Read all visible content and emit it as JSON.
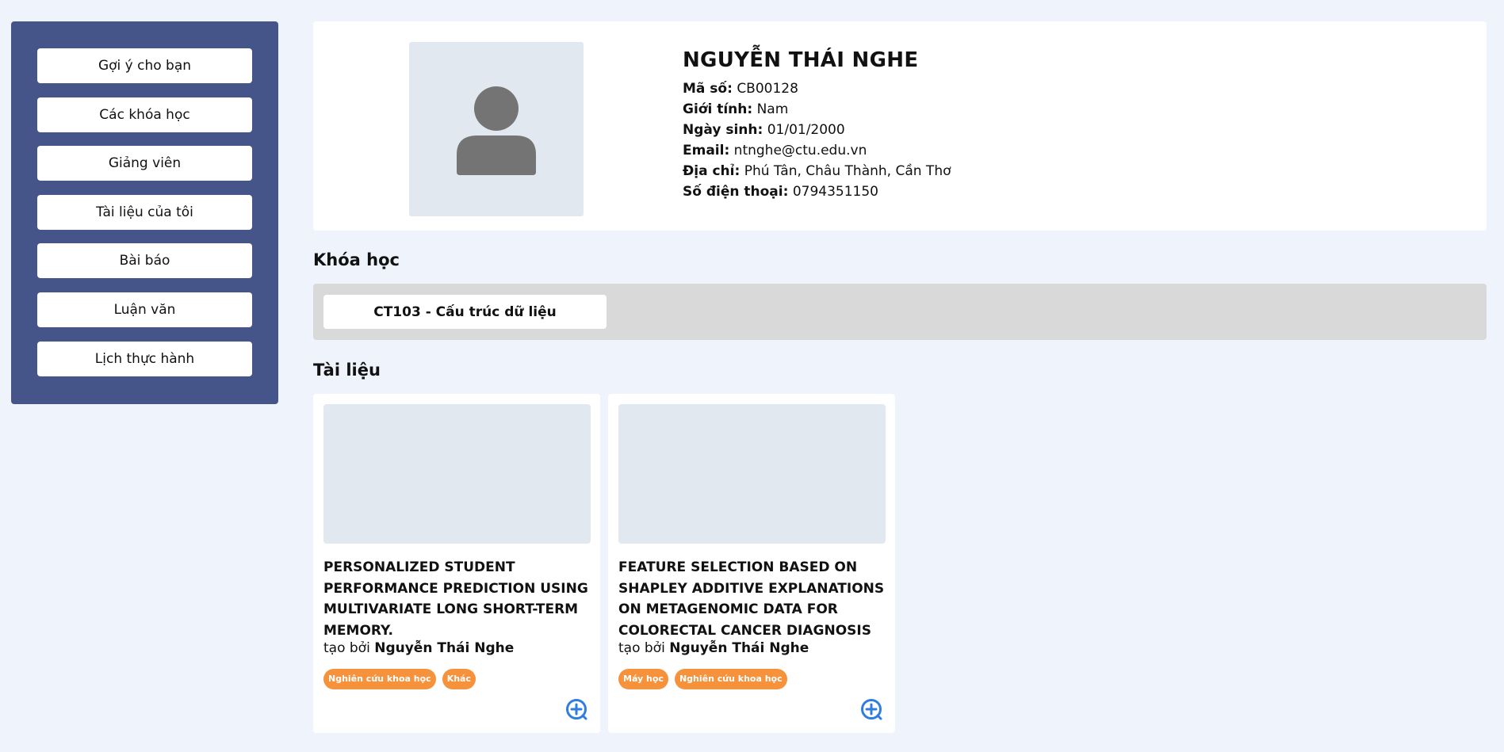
{
  "sidebar": {
    "items": [
      {
        "label": "Gợi ý cho bạn"
      },
      {
        "label": "Các khóa học"
      },
      {
        "label": "Giảng viên"
      },
      {
        "label": "Tài liệu của tôi"
      },
      {
        "label": "Bài báo"
      },
      {
        "label": "Luận văn"
      },
      {
        "label": "Lịch thực hành"
      }
    ]
  },
  "profile": {
    "name": "NGUYỄN THÁI NGHE",
    "fields": [
      {
        "label": "Mã số:",
        "value": "CB00128"
      },
      {
        "label": "Giới tính:",
        "value": "Nam"
      },
      {
        "label": "Ngày sinh:",
        "value": "01/01/2000"
      },
      {
        "label": "Email:",
        "value": "ntnghe@ctu.edu.vn"
      },
      {
        "label": "Địa chỉ:",
        "value": "Phú Tân, Châu Thành, Cần Thơ"
      },
      {
        "label": "Số điện thoại:",
        "value": "0794351150"
      }
    ]
  },
  "courses": {
    "title": "Khóa học",
    "items": [
      {
        "label": "CT103 - Cấu trúc dữ liệu"
      }
    ]
  },
  "documents": {
    "title": "Tài liệu",
    "author_prefix": "tạo bởi",
    "items": [
      {
        "title": "PERSONALIZED STUDENT PERFORMANCE PREDICTION USING MULTIVARIATE LONG SHORT-TERM MEMORY.",
        "author": "Nguyễn Thái Nghe",
        "tags": [
          "Nghiên cứu khoa học",
          "Khác"
        ]
      },
      {
        "title": "FEATURE SELECTION BASED ON SHAPLEY ADDITIVE EXPLANATIONS ON METAGENOMIC DATA FOR COLORECTAL CANCER DIAGNOSIS",
        "author": "Nguyễn Thái Nghe",
        "tags": [
          "Máy học",
          "Nghiên cứu khoa học"
        ]
      }
    ]
  },
  "colors": {
    "sidebar_bg": "#465589",
    "page_bg": "#eff3fb",
    "tag_bg": "#f6923c",
    "add_icon": "#2f7de1"
  },
  "icons": {
    "avatar": "user-silhouette-icon",
    "add": "plus-circle-icon"
  }
}
